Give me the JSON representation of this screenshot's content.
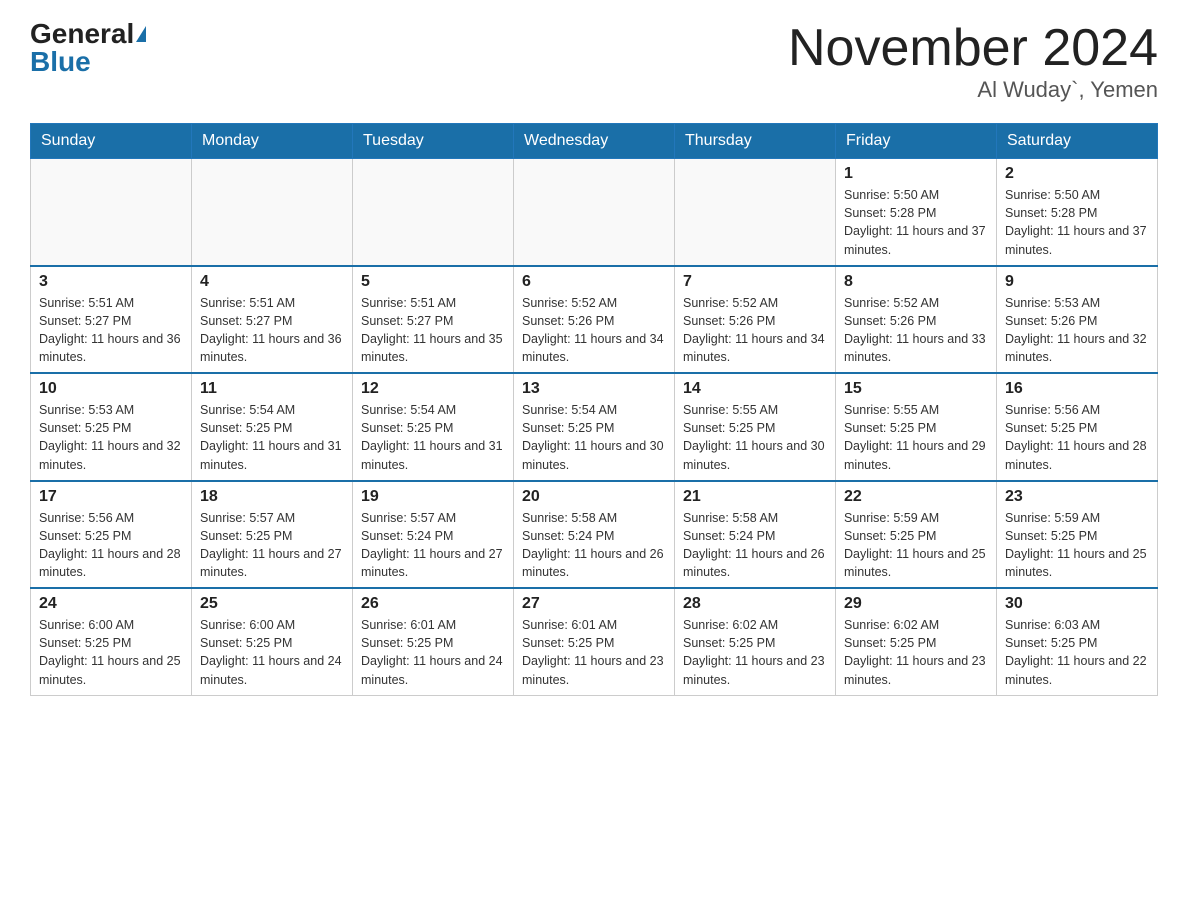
{
  "header": {
    "logo_general": "General",
    "logo_blue": "Blue",
    "month_title": "November 2024",
    "location": "Al Wuday`, Yemen"
  },
  "weekdays": [
    "Sunday",
    "Monday",
    "Tuesday",
    "Wednesday",
    "Thursday",
    "Friday",
    "Saturday"
  ],
  "weeks": [
    [
      {
        "day": "",
        "info": ""
      },
      {
        "day": "",
        "info": ""
      },
      {
        "day": "",
        "info": ""
      },
      {
        "day": "",
        "info": ""
      },
      {
        "day": "",
        "info": ""
      },
      {
        "day": "1",
        "info": "Sunrise: 5:50 AM\nSunset: 5:28 PM\nDaylight: 11 hours and 37 minutes."
      },
      {
        "day": "2",
        "info": "Sunrise: 5:50 AM\nSunset: 5:28 PM\nDaylight: 11 hours and 37 minutes."
      }
    ],
    [
      {
        "day": "3",
        "info": "Sunrise: 5:51 AM\nSunset: 5:27 PM\nDaylight: 11 hours and 36 minutes."
      },
      {
        "day": "4",
        "info": "Sunrise: 5:51 AM\nSunset: 5:27 PM\nDaylight: 11 hours and 36 minutes."
      },
      {
        "day": "5",
        "info": "Sunrise: 5:51 AM\nSunset: 5:27 PM\nDaylight: 11 hours and 35 minutes."
      },
      {
        "day": "6",
        "info": "Sunrise: 5:52 AM\nSunset: 5:26 PM\nDaylight: 11 hours and 34 minutes."
      },
      {
        "day": "7",
        "info": "Sunrise: 5:52 AM\nSunset: 5:26 PM\nDaylight: 11 hours and 34 minutes."
      },
      {
        "day": "8",
        "info": "Sunrise: 5:52 AM\nSunset: 5:26 PM\nDaylight: 11 hours and 33 minutes."
      },
      {
        "day": "9",
        "info": "Sunrise: 5:53 AM\nSunset: 5:26 PM\nDaylight: 11 hours and 32 minutes."
      }
    ],
    [
      {
        "day": "10",
        "info": "Sunrise: 5:53 AM\nSunset: 5:25 PM\nDaylight: 11 hours and 32 minutes."
      },
      {
        "day": "11",
        "info": "Sunrise: 5:54 AM\nSunset: 5:25 PM\nDaylight: 11 hours and 31 minutes."
      },
      {
        "day": "12",
        "info": "Sunrise: 5:54 AM\nSunset: 5:25 PM\nDaylight: 11 hours and 31 minutes."
      },
      {
        "day": "13",
        "info": "Sunrise: 5:54 AM\nSunset: 5:25 PM\nDaylight: 11 hours and 30 minutes."
      },
      {
        "day": "14",
        "info": "Sunrise: 5:55 AM\nSunset: 5:25 PM\nDaylight: 11 hours and 30 minutes."
      },
      {
        "day": "15",
        "info": "Sunrise: 5:55 AM\nSunset: 5:25 PM\nDaylight: 11 hours and 29 minutes."
      },
      {
        "day": "16",
        "info": "Sunrise: 5:56 AM\nSunset: 5:25 PM\nDaylight: 11 hours and 28 minutes."
      }
    ],
    [
      {
        "day": "17",
        "info": "Sunrise: 5:56 AM\nSunset: 5:25 PM\nDaylight: 11 hours and 28 minutes."
      },
      {
        "day": "18",
        "info": "Sunrise: 5:57 AM\nSunset: 5:25 PM\nDaylight: 11 hours and 27 minutes."
      },
      {
        "day": "19",
        "info": "Sunrise: 5:57 AM\nSunset: 5:24 PM\nDaylight: 11 hours and 27 minutes."
      },
      {
        "day": "20",
        "info": "Sunrise: 5:58 AM\nSunset: 5:24 PM\nDaylight: 11 hours and 26 minutes."
      },
      {
        "day": "21",
        "info": "Sunrise: 5:58 AM\nSunset: 5:24 PM\nDaylight: 11 hours and 26 minutes."
      },
      {
        "day": "22",
        "info": "Sunrise: 5:59 AM\nSunset: 5:25 PM\nDaylight: 11 hours and 25 minutes."
      },
      {
        "day": "23",
        "info": "Sunrise: 5:59 AM\nSunset: 5:25 PM\nDaylight: 11 hours and 25 minutes."
      }
    ],
    [
      {
        "day": "24",
        "info": "Sunrise: 6:00 AM\nSunset: 5:25 PM\nDaylight: 11 hours and 25 minutes."
      },
      {
        "day": "25",
        "info": "Sunrise: 6:00 AM\nSunset: 5:25 PM\nDaylight: 11 hours and 24 minutes."
      },
      {
        "day": "26",
        "info": "Sunrise: 6:01 AM\nSunset: 5:25 PM\nDaylight: 11 hours and 24 minutes."
      },
      {
        "day": "27",
        "info": "Sunrise: 6:01 AM\nSunset: 5:25 PM\nDaylight: 11 hours and 23 minutes."
      },
      {
        "day": "28",
        "info": "Sunrise: 6:02 AM\nSunset: 5:25 PM\nDaylight: 11 hours and 23 minutes."
      },
      {
        "day": "29",
        "info": "Sunrise: 6:02 AM\nSunset: 5:25 PM\nDaylight: 11 hours and 23 minutes."
      },
      {
        "day": "30",
        "info": "Sunrise: 6:03 AM\nSunset: 5:25 PM\nDaylight: 11 hours and 22 minutes."
      }
    ]
  ]
}
